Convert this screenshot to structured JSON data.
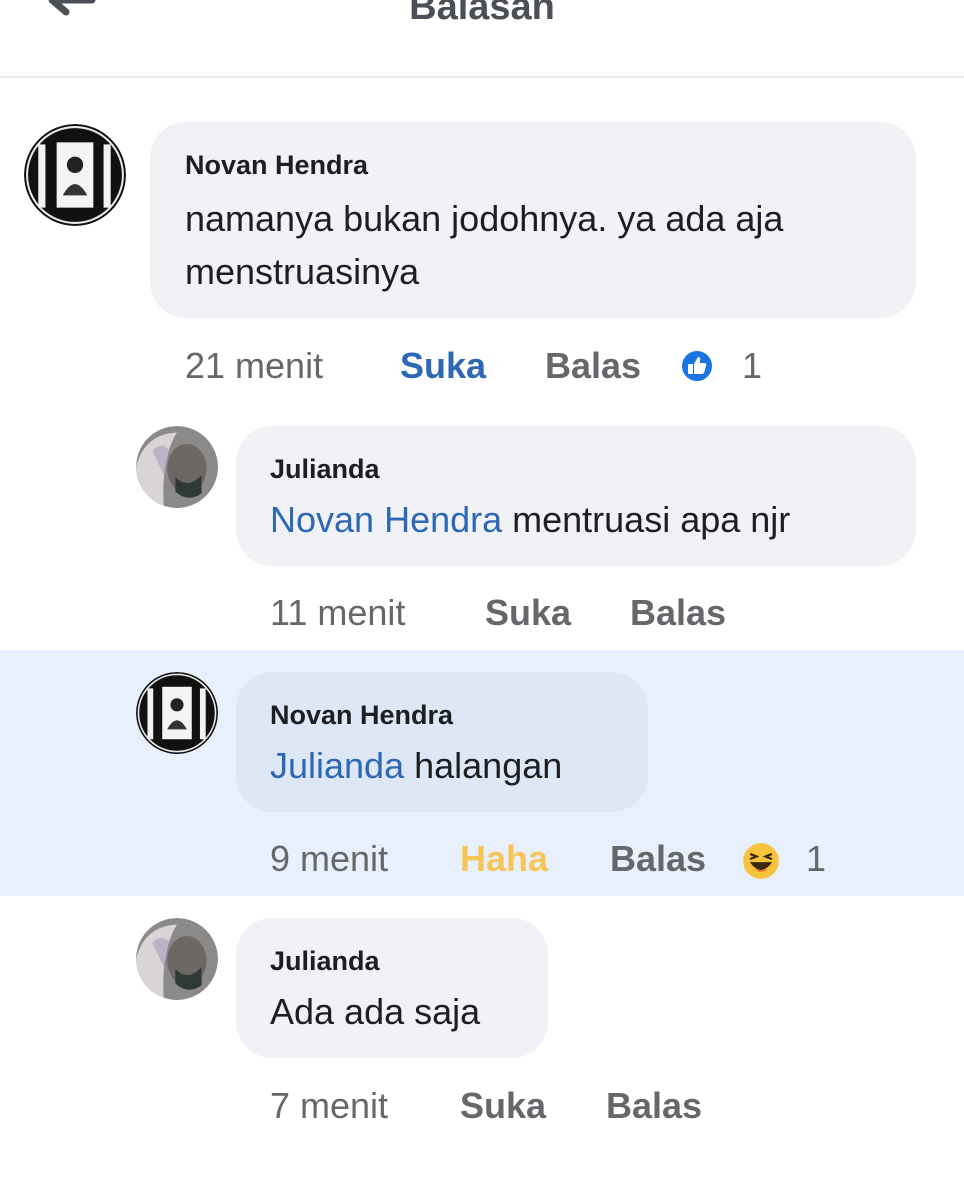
{
  "header": {
    "title": "Balasan",
    "back_icon": "back-arrow-icon"
  },
  "colors": {
    "like_blue": "#2d68b4",
    "haha_yellow": "#f7c556",
    "bubble_gray": "#f0f2f5",
    "highlight": "#e7f0fc",
    "meta_gray": "#65676b"
  },
  "comments": [
    {
      "author": "Novan Hendra",
      "mention": "",
      "text_line1": "namanya bukan jodohnya. ya ada aja",
      "text_line2": "menstruasinya",
      "time": "21 menit",
      "like_label": "Suka",
      "reply_label": "Balas",
      "reaction": "like-reaction-icon",
      "reaction_count": "1"
    },
    {
      "author": "Julianda",
      "mention": "Novan Hendra",
      "text": " mentruasi apa njr",
      "time": "11 menit",
      "like_label": "Suka",
      "reply_label": "Balas"
    },
    {
      "author": "Novan Hendra",
      "mention": "Julianda",
      "text": " halangan",
      "time": "9 menit",
      "like_label": "Haha",
      "reply_label": "Balas",
      "reaction": "haha-reaction-icon",
      "reaction_count": "1"
    },
    {
      "author": "Julianda",
      "mention": "",
      "text": "Ada ada saja",
      "time": "7 menit",
      "like_label": "Suka",
      "reply_label": "Balas"
    }
  ]
}
